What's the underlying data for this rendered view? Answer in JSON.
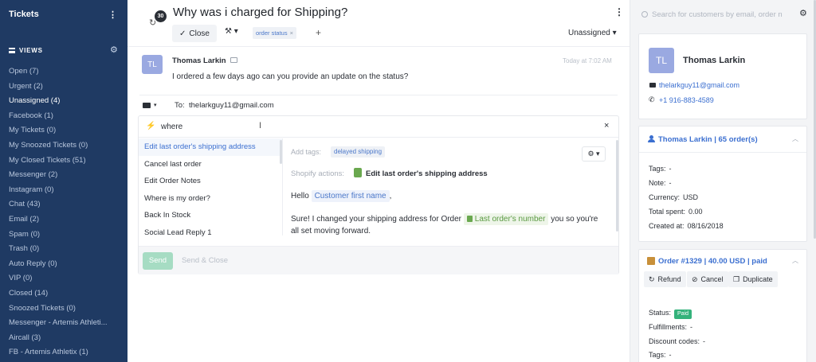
{
  "sidebar": {
    "title": "Tickets",
    "views_label": "VIEWS",
    "items": [
      "Open (7)",
      "Urgent (2)",
      "Unassigned (4)",
      "Facebook (1)",
      "My Tickets (0)",
      "My Snoozed Tickets (0)",
      "My Closed Tickets (51)",
      "Messenger (2)",
      "Instagram (0)",
      "Chat (43)",
      "Email (2)",
      "Spam (0)",
      "Trash (0)",
      "Auto Reply (0)",
      "VIP (0)",
      "Closed (14)",
      "Snoozed Tickets (0)",
      "Messenger - Artemis Athleti...",
      "Aircall (3)",
      "FB - Artemis Athletix (1)"
    ],
    "active_index": 2
  },
  "ticket": {
    "badge_count": "30",
    "title": "Why was i charged for Shipping?",
    "close_label": "Close",
    "tag": "order status",
    "assignee": "Unassigned"
  },
  "message": {
    "avatar": "TL",
    "author": "Thomas Larkin",
    "time": "Today at 7:02 AM",
    "body": "I ordered a few days ago can you provide an update on the status?"
  },
  "reply": {
    "to_label": "To:",
    "to_email": "thelarkguy11@gmail.com"
  },
  "macros": {
    "search_value": "where",
    "items": [
      "Edit last order's shipping address",
      "Cancel last order",
      "Edit Order Notes",
      "Where is my order?",
      "Back In Stock",
      "Social Lead Reply 1"
    ],
    "selected_index": 0,
    "preview": {
      "add_tags_label": "Add tags:",
      "tag": "delayed shipping",
      "shopify_label": "Shopify actions:",
      "shopify_action": "Edit last order's shipping address",
      "hello": "Hello",
      "var_first_name": "Customer first name",
      "comma": ",",
      "line2_pre": "Sure! I changed your shipping address for Order",
      "var_last_order": "Last order's number",
      "line2_post": "you so you're",
      "line3": "all set moving forward."
    },
    "send_label": "Send",
    "send_close_label": "Send & Close"
  },
  "customer": {
    "search_placeholder": "Search for customers by email, order n",
    "avatar": "TL",
    "name": "Thomas Larkin",
    "email": "thelarkguy11@gmail.com",
    "phone": "+1 916-883-4589",
    "summary_title": "Thomas Larkin | 65 order(s)",
    "fields": [
      {
        "label": "Tags:",
        "value": "-"
      },
      {
        "label": "Note:",
        "value": "-"
      },
      {
        "label": "Currency:",
        "value": "USD"
      },
      {
        "label": "Total spent:",
        "value": "0.00"
      },
      {
        "label": "Created at:",
        "value": "08/16/2018"
      }
    ],
    "order_title": "Order #1329 | 40.00 USD | paid",
    "order_actions": [
      "Refund",
      "Cancel",
      "Duplicate"
    ],
    "status_label": "Status:",
    "status_value": "Paid",
    "order_fields": [
      {
        "label": "Fulfillments:",
        "value": "-"
      },
      {
        "label": "Discount codes:",
        "value": "-"
      },
      {
        "label": "Tags:",
        "value": "-"
      }
    ]
  },
  "colors": {
    "sidebar_bg": "#1f3a63",
    "accent": "#3b6fd0",
    "paid_green": "#34b27b",
    "send_green": "#a6dcc3"
  }
}
